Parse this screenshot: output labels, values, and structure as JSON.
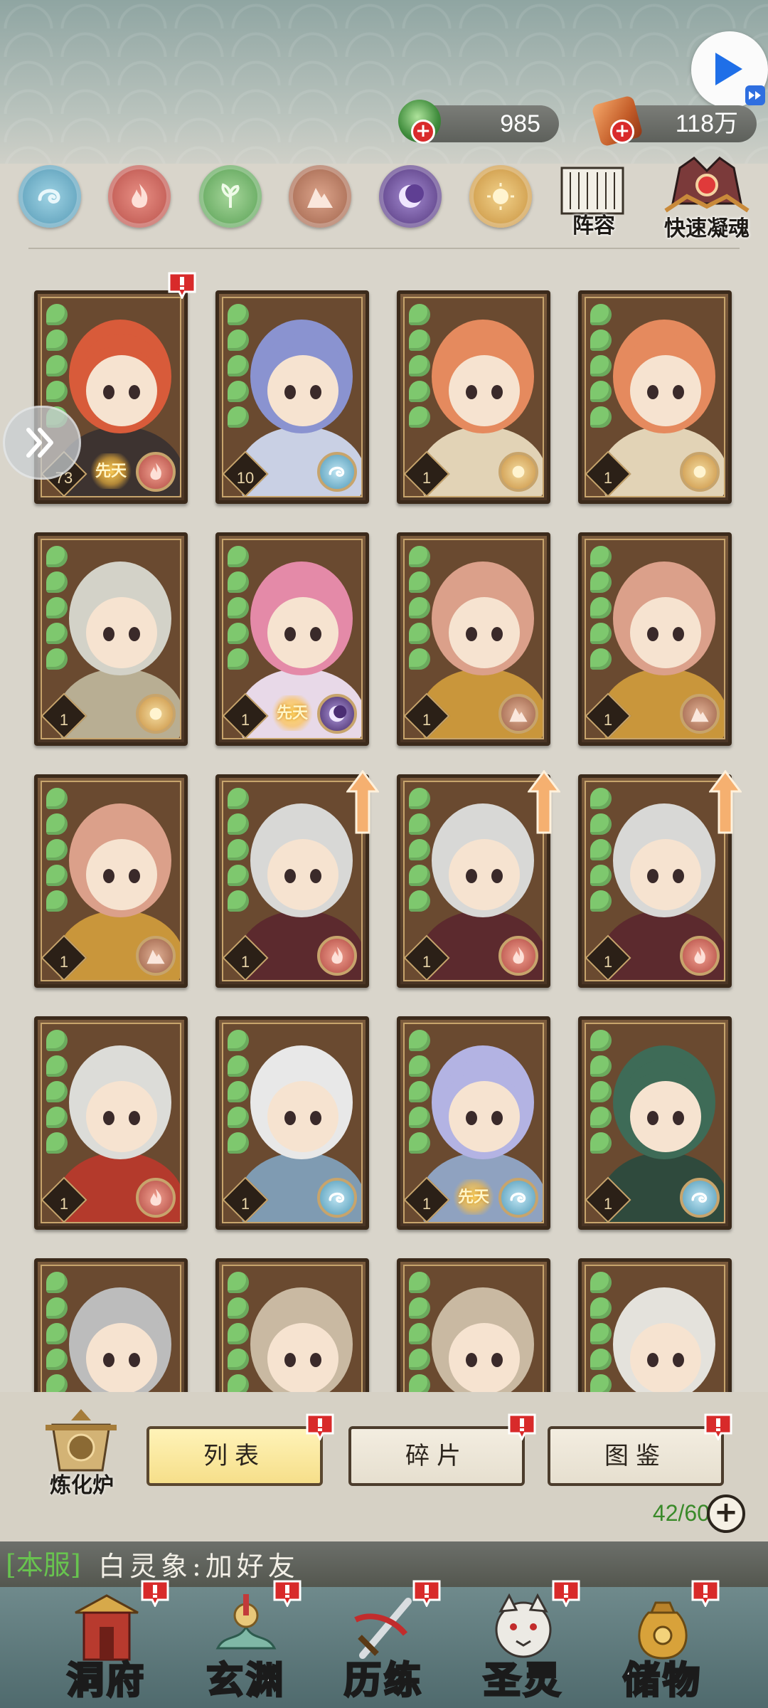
{
  "currencies": {
    "jade": {
      "value": "985",
      "icon": "jade-icon"
    },
    "coin": {
      "value": "118万",
      "icon": "copper-coin-icon"
    }
  },
  "toolbar": {
    "lineup_label": "阵容",
    "quick_label": "快速凝魂"
  },
  "element_filters": [
    "water",
    "fire",
    "wood",
    "earth",
    "dark",
    "light"
  ],
  "heroes": [
    {
      "level": "73",
      "element": "fire",
      "innate": "先天",
      "alert": true,
      "palette": [
        "#d85b3a",
        "#3d3330"
      ]
    },
    {
      "level": "10",
      "element": "water",
      "innate": "",
      "alert": false,
      "palette": [
        "#8a93d0",
        "#c9d0e4"
      ]
    },
    {
      "level": "1",
      "element": "light",
      "innate": "",
      "alert": false,
      "palette": [
        "#e58a5e",
        "#e2d3b6"
      ]
    },
    {
      "level": "1",
      "element": "light",
      "innate": "",
      "alert": false,
      "palette": [
        "#e58a5e",
        "#e2d3b6"
      ]
    },
    {
      "level": "1",
      "element": "light",
      "innate": "",
      "alert": false,
      "palette": [
        "#d3d2c8",
        "#b8ae93"
      ]
    },
    {
      "level": "1",
      "element": "dark",
      "innate": "先天",
      "alert": false,
      "palette": [
        "#e48aa8",
        "#e8d9e8"
      ]
    },
    {
      "level": "1",
      "element": "earth",
      "innate": "",
      "alert": false,
      "palette": [
        "#dba08a",
        "#c9963b"
      ]
    },
    {
      "level": "1",
      "element": "earth",
      "innate": "",
      "alert": false,
      "palette": [
        "#dba08a",
        "#c9963b"
      ]
    },
    {
      "level": "1",
      "element": "earth",
      "innate": "",
      "alert": false,
      "palette": [
        "#dba08a",
        "#c9963b"
      ]
    },
    {
      "level": "1",
      "element": "fire",
      "innate": "",
      "alert": false,
      "upgrade": true,
      "palette": [
        "#d8d8d6",
        "#5c2a2e"
      ]
    },
    {
      "level": "1",
      "element": "fire",
      "innate": "",
      "alert": false,
      "upgrade": true,
      "palette": [
        "#d8d8d6",
        "#5c2a2e"
      ]
    },
    {
      "level": "1",
      "element": "fire",
      "innate": "",
      "alert": false,
      "upgrade": true,
      "palette": [
        "#d8d8d6",
        "#5c2a2e"
      ]
    },
    {
      "level": "1",
      "element": "fire",
      "innate": "",
      "alert": false,
      "palette": [
        "#dcdcd8",
        "#b43a2c"
      ]
    },
    {
      "level": "1",
      "element": "water",
      "innate": "",
      "alert": false,
      "palette": [
        "#e8e8e8",
        "#7f9bb2"
      ]
    },
    {
      "level": "1",
      "element": "water",
      "innate": "先天",
      "alert": false,
      "palette": [
        "#b3b3e3",
        "#8fa2c0"
      ]
    },
    {
      "level": "1",
      "element": "water",
      "innate": "",
      "alert": false,
      "palette": [
        "#3e6b57",
        "#2f4a3d"
      ]
    },
    {
      "level": "",
      "element": "",
      "innate": "",
      "alert": false,
      "palette": [
        "#bcbcbc",
        "#5a5040"
      ]
    },
    {
      "level": "",
      "element": "",
      "innate": "",
      "alert": false,
      "palette": [
        "#c9b9a2",
        "#8f2a2a"
      ]
    },
    {
      "level": "",
      "element": "",
      "innate": "",
      "alert": false,
      "palette": [
        "#c9b9a2",
        "#8f2a2a"
      ]
    },
    {
      "level": "",
      "element": "",
      "innate": "",
      "alert": false,
      "palette": [
        "#e4e2dc",
        "#a12a2a"
      ]
    }
  ],
  "furnace_label": "炼化炉",
  "tabs": [
    {
      "label": "列表",
      "active": true,
      "alert": true
    },
    {
      "label": "碎片",
      "active": false,
      "alert": true
    },
    {
      "label": "图鉴",
      "active": false,
      "alert": true
    }
  ],
  "capacity": "42/60",
  "chat": {
    "channel": "[本服]",
    "message": "白灵象:加好友"
  },
  "nav": [
    {
      "label": "洞府",
      "icon": "cave-mansion-icon",
      "alert": true
    },
    {
      "label": "玄渊",
      "icon": "abyss-icon",
      "alert": true
    },
    {
      "label": "历练",
      "icon": "sword-training-icon",
      "alert": true
    },
    {
      "label": "圣灵",
      "icon": "spirit-beast-icon",
      "alert": true
    },
    {
      "label": "储物",
      "icon": "storage-bag-icon",
      "alert": true
    }
  ]
}
